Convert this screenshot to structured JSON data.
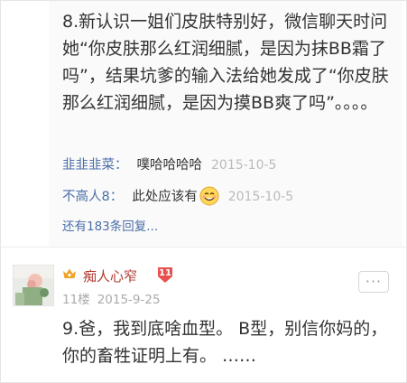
{
  "post1": {
    "text": "8.新认识一姐们皮肤特别好，微信聊天时问她“你皮肤那么红润细腻，是因为抹BB霜了吗”，结果坑爹的输入法给她发成了“你皮肤那么红润细腻，是因为摸BB爽了吗”。。。。"
  },
  "replies": [
    {
      "user": "韭韭韭菜：",
      "content": "噗哈哈哈哈",
      "date": "2015-10-5"
    },
    {
      "user": "不高人8：",
      "content": "此处应该有",
      "emoji": "smile-emoji",
      "date": "2015-10-5"
    }
  ],
  "more_replies": "还有183条回复...",
  "post2": {
    "username": "痴人心窄",
    "level": "11",
    "floor": "11楼",
    "date": "2015-9-25",
    "more_button": "···",
    "text": "9.爸，我到底啥血型。 B型，别信你妈的，你的畜牲证明上有。 ……"
  },
  "colors": {
    "link": "#4a6ea8",
    "username": "#b03a2e",
    "badge": "#e8504f",
    "crown": "#f0a328"
  }
}
